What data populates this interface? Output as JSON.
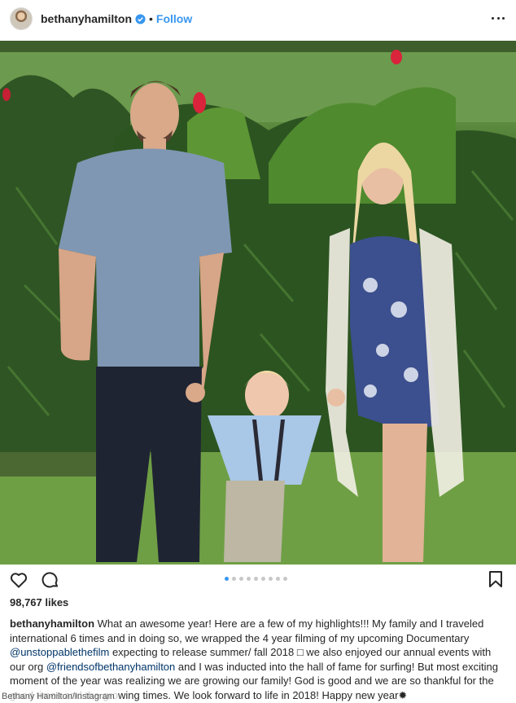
{
  "header": {
    "username": "bethanyhamilton",
    "separator": "•",
    "follow_label": "Follow",
    "verified_icon": "verified-badge-icon",
    "more_icon": "more-options-icon"
  },
  "photo": {
    "description_icon": "post-photo"
  },
  "actions": {
    "like_icon": "heart-icon",
    "comment_icon": "comment-icon",
    "save_icon": "bookmark-icon",
    "carousel_total": 9,
    "carousel_active": 1
  },
  "likes": "98,767 likes",
  "caption": {
    "username": "bethanyhamilton",
    "part1": " What an awesome year! Here are a few of my highlights!!! My family and I traveled international 6 times and in doing so, we wrapped the 4 year filming of my upcoming Documentary ",
    "mention1": "@unstoppablethefilm",
    "part2": " expecting to release summer/ fall 2018 □ we also enjoyed our annual events with our org ",
    "mention2": "@friendsofbethanyhamilton",
    "part3": " and I was inducted into the hall of fame for surfing! But most exciting moment of the year was realizing we are growing our family! God is good and we are so thankful for the good times and the growing times. We look forward to life in 2018! Happy new year✹"
  },
  "credit": "Bethany Hamilton/Instagram",
  "colors": {
    "link_blue": "#3897f0",
    "mention_blue": "#003569",
    "text": "#262626"
  }
}
